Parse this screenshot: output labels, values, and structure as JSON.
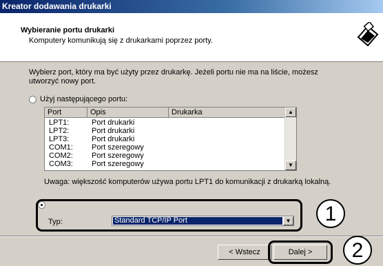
{
  "window": {
    "title": "Kreator dodawania drukarki"
  },
  "header": {
    "title": "Wybieranie portu drukarki",
    "subtitle": "Komputery komunikują się z drukarkami poprzez porty.",
    "icon": "printer-port-icon"
  },
  "intro_text": "Wybierz port, który ma być użyty przez drukarkę. Jeżeli portu nie ma na liście, możesz utworzyć nowy port.",
  "use_existing": {
    "label": "Użyj następującego portu:",
    "selected": false
  },
  "port_list": {
    "columns": [
      "Port",
      "Opis",
      "Drukarka"
    ],
    "rows": [
      {
        "port": "LPT1:",
        "desc": "Port drukarki",
        "printer": ""
      },
      {
        "port": "LPT2:",
        "desc": "Port drukarki",
        "printer": ""
      },
      {
        "port": "LPT3:",
        "desc": "Port drukarki",
        "printer": ""
      },
      {
        "port": "COM1:",
        "desc": "Port szeregowy",
        "printer": ""
      },
      {
        "port": "COM2:",
        "desc": "Port szeregowy",
        "printer": ""
      },
      {
        "port": "COM3:",
        "desc": "Port szeregowy",
        "printer": ""
      }
    ]
  },
  "note": "Uwaga: większość komputerów używa portu LPT1 do komunikacji z drukarką lokalną.",
  "create_new": {
    "selected": true
  },
  "type_field": {
    "label": "Typ:",
    "value": "Standard TCP/IP Port"
  },
  "callouts": [
    "1",
    "2"
  ],
  "buttons": {
    "back": "< Wstecz",
    "next": "Dalej >"
  }
}
